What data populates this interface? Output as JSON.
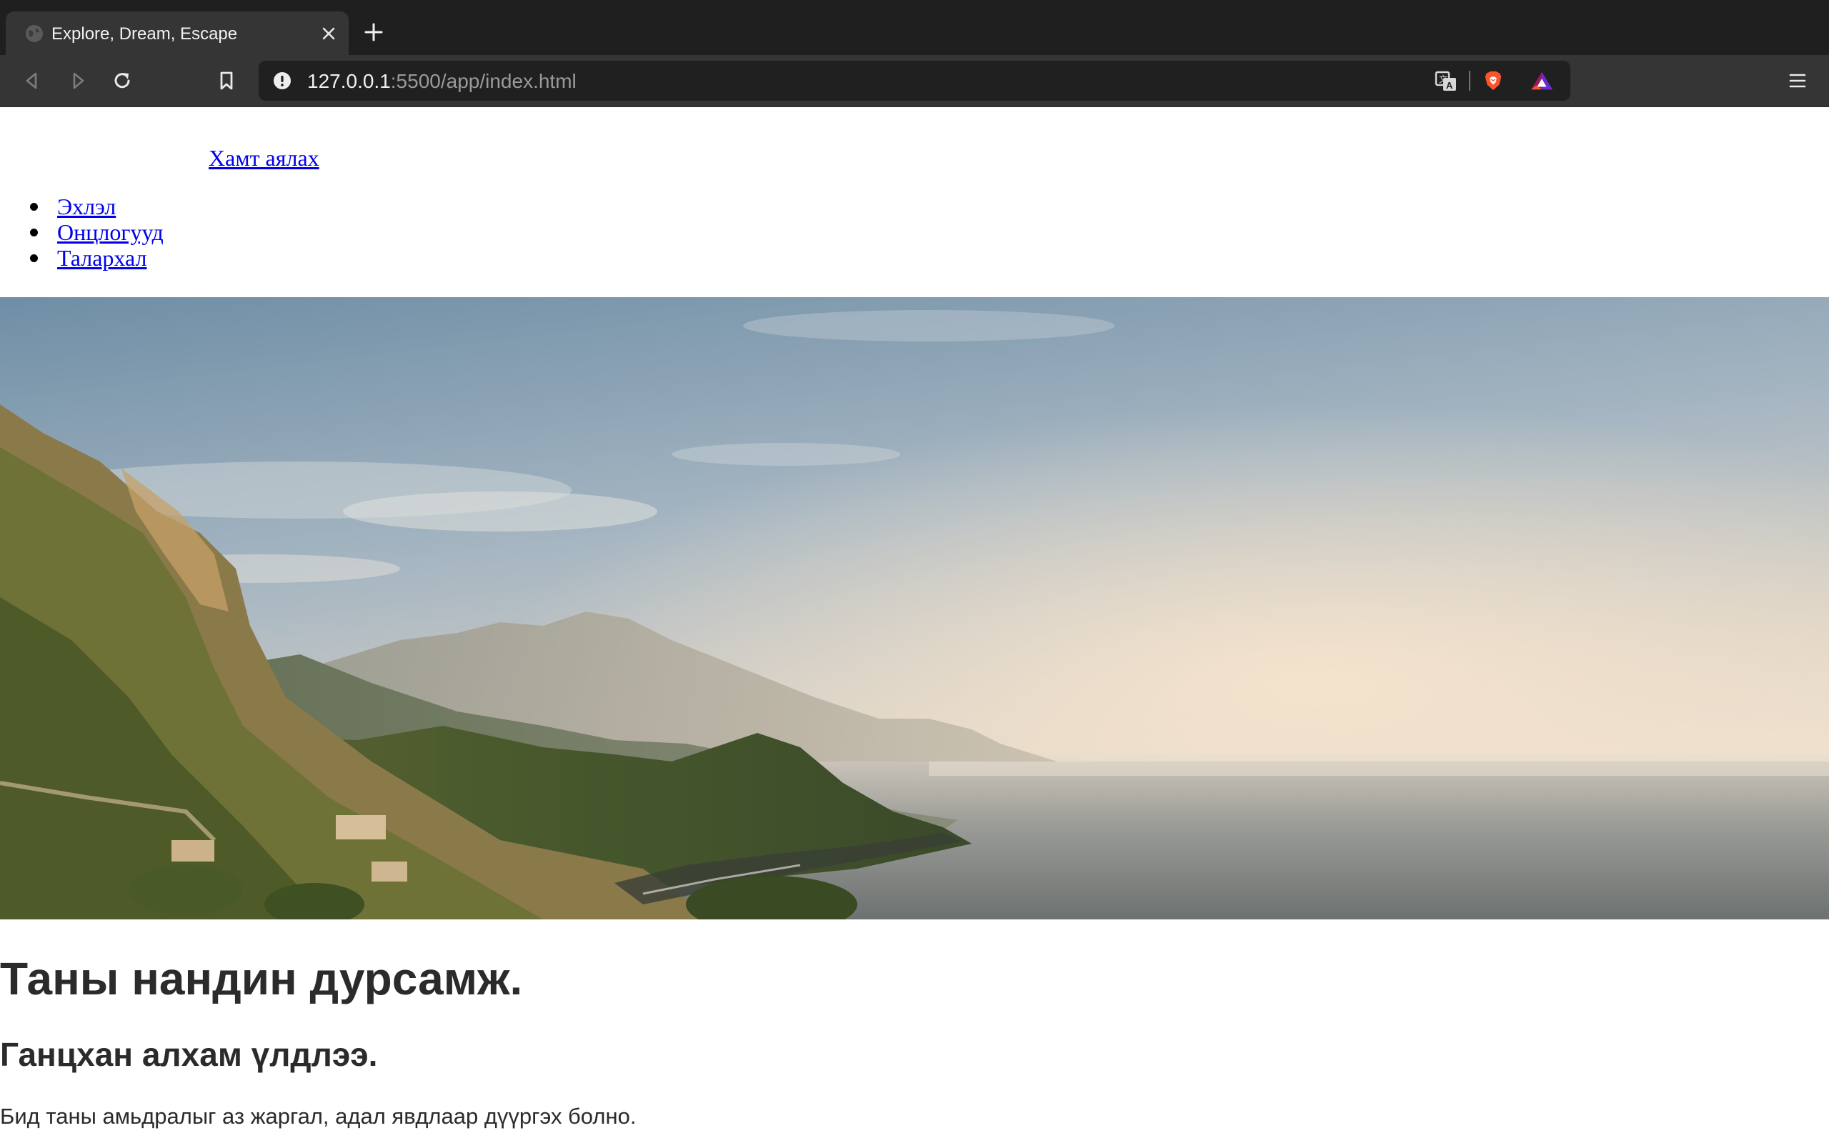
{
  "browser": {
    "tab": {
      "title": "Explore, Dream, Escape",
      "favicon": "globe-icon"
    },
    "address_bar": {
      "host": "127.0.0.1",
      "path": ":5500/app/index.html",
      "security_icon": "info-icon"
    },
    "toolbar_icons": [
      "back-icon",
      "forward-icon",
      "reload-icon",
      "bookmark-icon",
      "translate-icon",
      "brave-shield-icon",
      "brave-rewards-icon",
      "menu-icon"
    ]
  },
  "page": {
    "brand_link": "Хамт аялах",
    "nav": {
      "items": [
        {
          "label": "Эхлэл"
        },
        {
          "label": "Онцлогууд"
        },
        {
          "label": "Талархал"
        }
      ]
    },
    "hero": {
      "description": "coastal-landscape-photo"
    },
    "headline": "Таны нандин дурсамж.",
    "subheadline": "Ганцхан алхам үлдлээ.",
    "paragraph": "Бид таны амьдралыг аз жаргал, адал явдлаар дүүргэх болно."
  },
  "colors": {
    "tabstrip": "#1f1f1f",
    "toolbar": "#353535",
    "omnibox": "#202020",
    "link": "#0000ee",
    "heading_text": "#2b2b2b"
  }
}
